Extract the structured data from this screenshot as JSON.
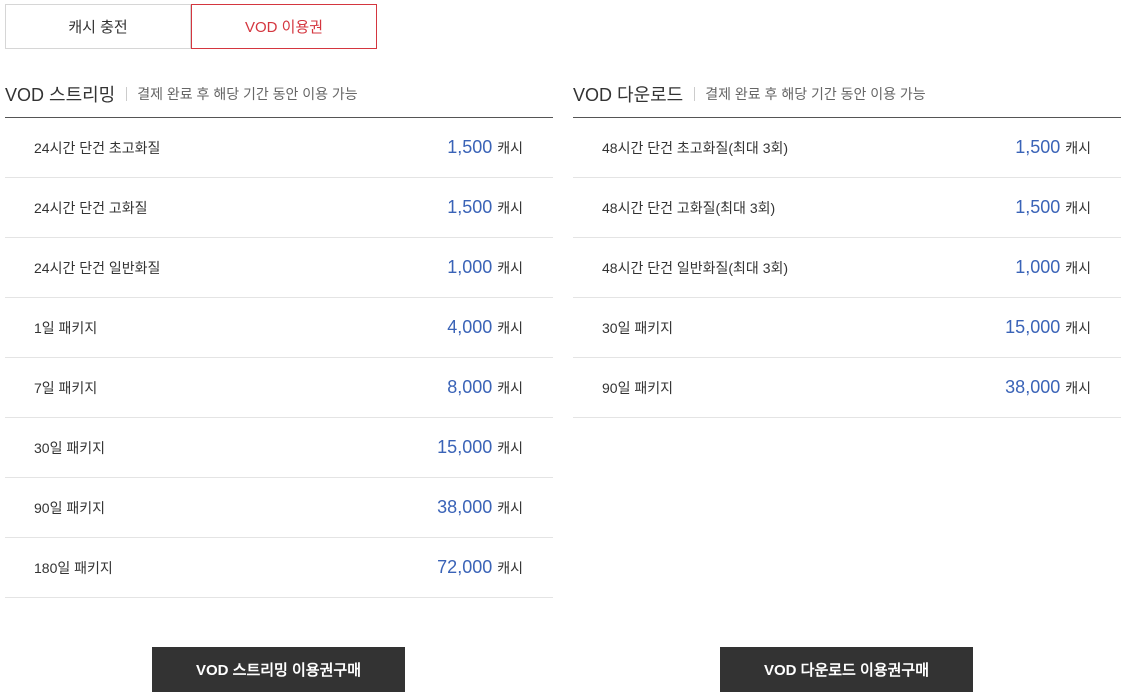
{
  "tabs": [
    {
      "label": "캐시 충전",
      "active": false
    },
    {
      "label": "VOD 이용권",
      "active": true
    }
  ],
  "streaming": {
    "title": "VOD 스트리밍",
    "desc": "결제 완료 후 해당 기간 동안 이용 가능",
    "plans": [
      {
        "name": "24시간 단건 초고화질",
        "price": "1,500",
        "unit": "캐시"
      },
      {
        "name": "24시간 단건 고화질",
        "price": "1,500",
        "unit": "캐시"
      },
      {
        "name": "24시간 단건 일반화질",
        "price": "1,000",
        "unit": "캐시"
      },
      {
        "name": "1일 패키지",
        "price": "4,000",
        "unit": "캐시"
      },
      {
        "name": "7일 패키지",
        "price": "8,000",
        "unit": "캐시"
      },
      {
        "name": "30일 패키지",
        "price": "15,000",
        "unit": "캐시"
      },
      {
        "name": "90일 패키지",
        "price": "38,000",
        "unit": "캐시"
      },
      {
        "name": "180일 패키지",
        "price": "72,000",
        "unit": "캐시"
      }
    ],
    "button_label": "VOD 스트리밍 이용권구매"
  },
  "download": {
    "title": "VOD 다운로드",
    "desc": "결제 완료 후 해당 기간 동안 이용 가능",
    "plans": [
      {
        "name": "48시간 단건 초고화질(최대 3회)",
        "price": "1,500",
        "unit": "캐시"
      },
      {
        "name": "48시간 단건 고화질(최대 3회)",
        "price": "1,500",
        "unit": "캐시"
      },
      {
        "name": "48시간 단건 일반화질(최대 3회)",
        "price": "1,000",
        "unit": "캐시"
      },
      {
        "name": "30일 패키지",
        "price": "15,000",
        "unit": "캐시"
      },
      {
        "name": "90일 패키지",
        "price": "38,000",
        "unit": "캐시"
      }
    ],
    "button_label": "VOD 다운로드 이용권구매"
  },
  "colors": {
    "accent_red": "#d4363f",
    "price_blue": "#3a63b7",
    "button_dark": "#333333"
  }
}
